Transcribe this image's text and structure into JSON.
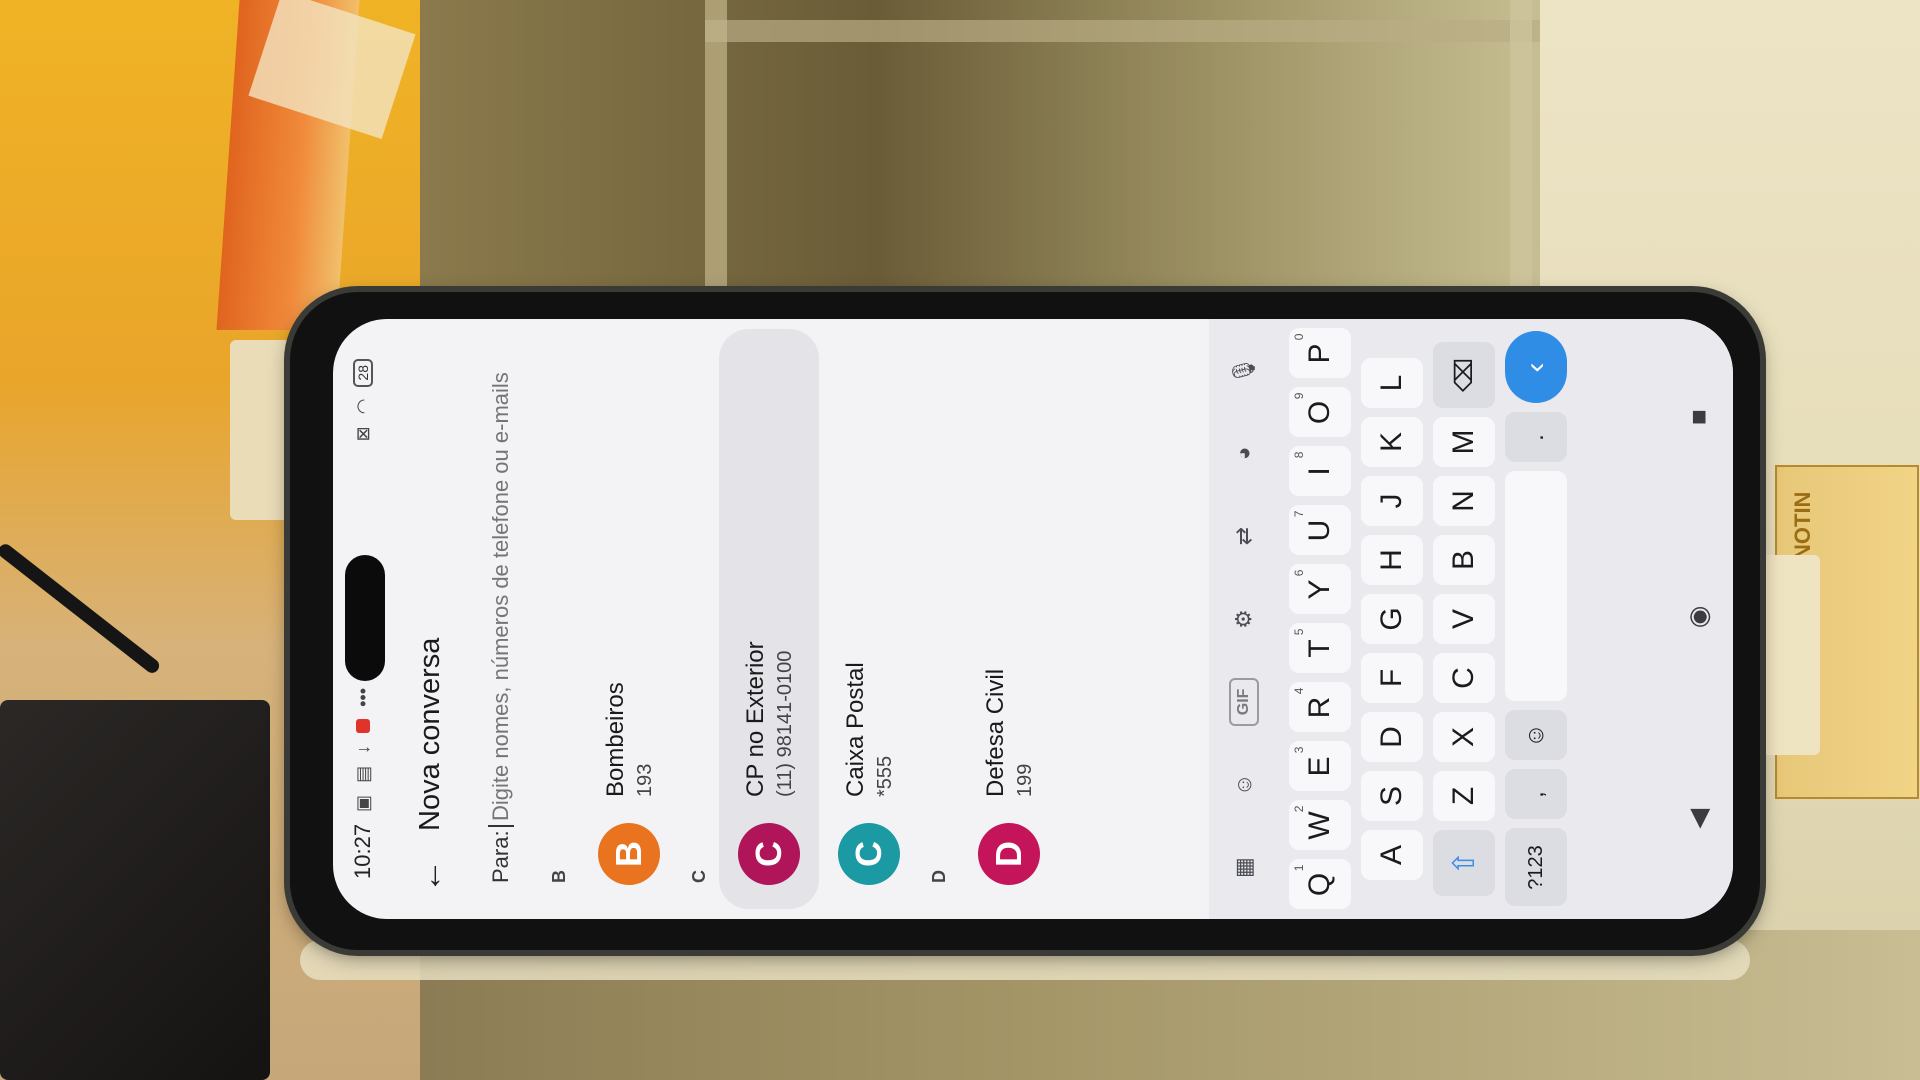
{
  "status_bar": {
    "time": "10:27",
    "battery": "28"
  },
  "header": {
    "back_icon": "back-arrow-icon",
    "title": "Nova conversa"
  },
  "to_field": {
    "label": "Para:",
    "placeholder": "Digite nomes, números de telefone ou e-mails"
  },
  "contacts": [
    {
      "section": "B",
      "initial": "B",
      "name": "Bombeiros",
      "number": "193",
      "color": "#e9731f",
      "highlighted": false
    },
    {
      "section": "C",
      "initial": "C",
      "name": "CP no Exterior",
      "number": "(11) 98141-0100",
      "color": "#b0155a",
      "highlighted": true
    },
    {
      "section": "",
      "initial": "C",
      "name": "Caixa Postal",
      "number": "*555",
      "color": "#1c9aa3",
      "highlighted": false
    },
    {
      "section": "D",
      "initial": "D",
      "name": "Defesa Civil",
      "number": "199",
      "color": "#c4145a",
      "highlighted": false
    }
  ],
  "keyboard": {
    "toolbar": [
      "apps-grid-icon",
      "sticker-icon",
      "GIF",
      "settings-gear-icon",
      "translate-icon",
      "palette-icon",
      "microphone-icon"
    ],
    "gif_label": "GIF",
    "row1": [
      {
        "k": "Q",
        "h": "1"
      },
      {
        "k": "W",
        "h": "2"
      },
      {
        "k": "E",
        "h": "3"
      },
      {
        "k": "R",
        "h": "4"
      },
      {
        "k": "T",
        "h": "5"
      },
      {
        "k": "Y",
        "h": "6"
      },
      {
        "k": "U",
        "h": "7"
      },
      {
        "k": "I",
        "h": "8"
      },
      {
        "k": "O",
        "h": "9"
      },
      {
        "k": "P",
        "h": "0"
      }
    ],
    "row2": [
      "A",
      "S",
      "D",
      "F",
      "G",
      "H",
      "J",
      "K",
      "L"
    ],
    "row3": [
      "Z",
      "X",
      "C",
      "V",
      "B",
      "N",
      "M"
    ],
    "num_key": "?123",
    "comma": ",",
    "period": ".",
    "emoji_icon": "emoji-icon",
    "shift_icon": "shift-arrow-icon",
    "backspace_icon": "backspace-icon",
    "enter_icon": "enter-chevron-icon"
  },
  "nav_bar": [
    "back-triangle-icon",
    "home-circle-icon",
    "recents-square-icon"
  ],
  "scene": {
    "label_text": "NOTIN"
  }
}
